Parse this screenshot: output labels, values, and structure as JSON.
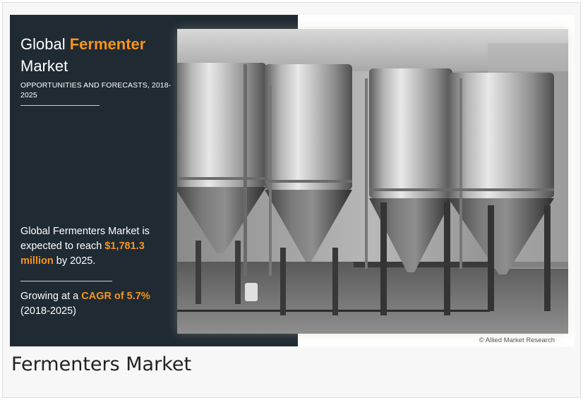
{
  "infographic": {
    "title_prefix": "Global",
    "title_accent": "Fermenter",
    "title_line2": "Market",
    "subtitle": "OPPORTUNITIES AND FORECASTS, 2018-2025",
    "stat1_text": "Global Fermenters Market is expected to reach",
    "stat1_value": "$1,781.3 million",
    "stat1_suffix": "by 2025.",
    "stat2_prefix": "Growing at a",
    "stat2_value": "CAGR of 5.7%",
    "stat2_period": "(2018-2025)",
    "copyright": "© Allied Market Research"
  },
  "caption": "Fermenters Market",
  "colors": {
    "panel": "#1f2a33",
    "accent": "#f7941d",
    "frame_bg": "#f7f7f7"
  }
}
